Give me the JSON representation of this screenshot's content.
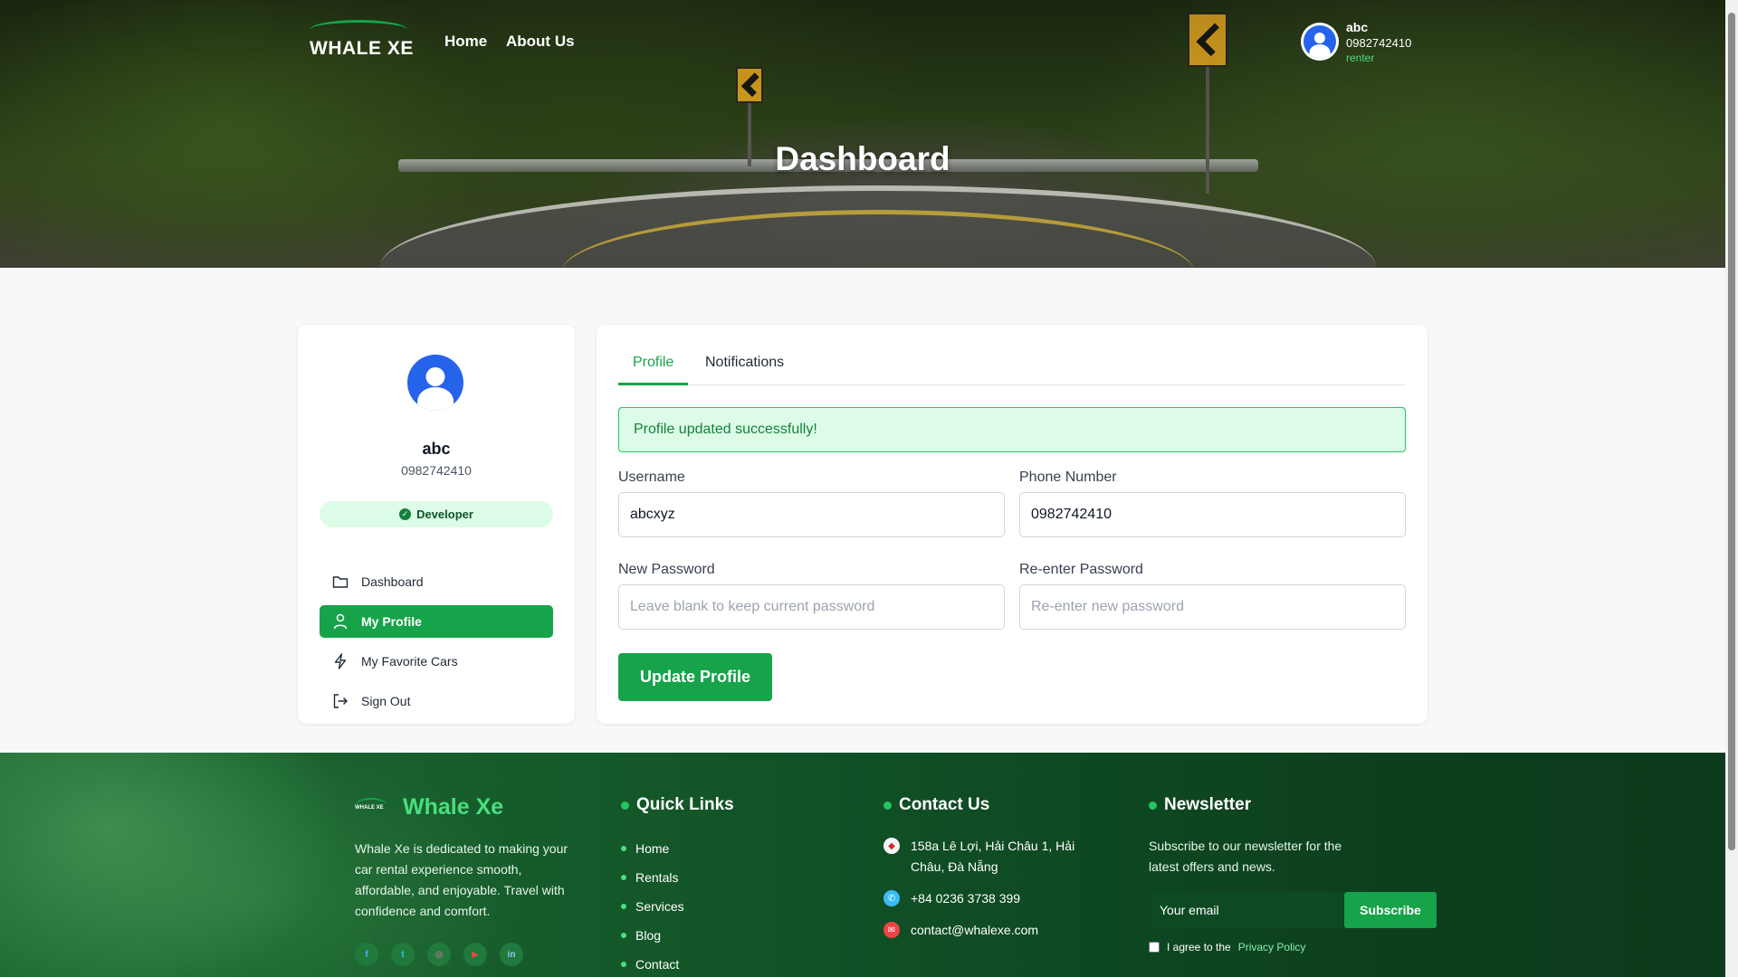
{
  "header": {
    "logo_text": "WHALE XE",
    "nav": [
      {
        "label": "Home"
      },
      {
        "label": "About Us"
      }
    ],
    "user": {
      "name": "abc",
      "phone": "0982742410",
      "role": "renter"
    },
    "hero_title": "Dashboard"
  },
  "sidebar": {
    "name": "abc",
    "phone": "0982742410",
    "badge": "Developer",
    "menu": [
      {
        "label": "Dashboard",
        "icon": "folder-icon",
        "active": false
      },
      {
        "label": "My Profile",
        "icon": "user-icon",
        "active": true
      },
      {
        "label": "My Favorite Cars",
        "icon": "lightning-icon",
        "active": false
      },
      {
        "label": "Sign Out",
        "icon": "sign-out-icon",
        "active": false
      }
    ]
  },
  "main": {
    "tabs": [
      {
        "label": "Profile",
        "active": true
      },
      {
        "label": "Notifications",
        "active": false
      }
    ],
    "alert": "Profile updated successfully!",
    "form": {
      "username_label": "Username",
      "username_value": "abcxyz",
      "phone_label": "Phone Number",
      "phone_value": "0982742410",
      "new_password_label": "New Password",
      "new_password_placeholder": "Leave blank to keep current password",
      "reenter_label": "Re-enter Password",
      "reenter_placeholder": "Re-enter new password",
      "submit_label": "Update Profile"
    }
  },
  "footer": {
    "brand_name": "Whale Xe",
    "brand_mini": "WHALE XE",
    "about": "Whale Xe is dedicated to making your car rental experience smooth, affordable, and enjoyable. Travel with confidence and comfort.",
    "social": [
      "facebook-icon",
      "twitter-icon",
      "instagram-icon",
      "youtube-icon",
      "linkedin-icon"
    ],
    "quick_links_title": "Quick Links",
    "quick_links": [
      "Home",
      "Rentals",
      "Services",
      "Blog",
      "Contact"
    ],
    "contact_title": "Contact Us",
    "contact": {
      "address": "158a Lê Lợi, Hải Châu 1, Hải Châu, Đà Nẵng",
      "phone": "+84 0236 3738 399",
      "email": "contact@whalexe.com"
    },
    "newsletter_title": "Newsletter",
    "newsletter_text": "Subscribe to our newsletter for the latest offers and news.",
    "email_placeholder": "Your email",
    "subscribe_label": "Subscribe",
    "agree_prefix": "I agree to the",
    "agree_link": "Privacy Policy"
  },
  "colors": {
    "accent": "#16a34a",
    "avatar_blue": "#2563eb",
    "alert_bg": "#dcfce7",
    "footer_green": "#0f4d24"
  }
}
